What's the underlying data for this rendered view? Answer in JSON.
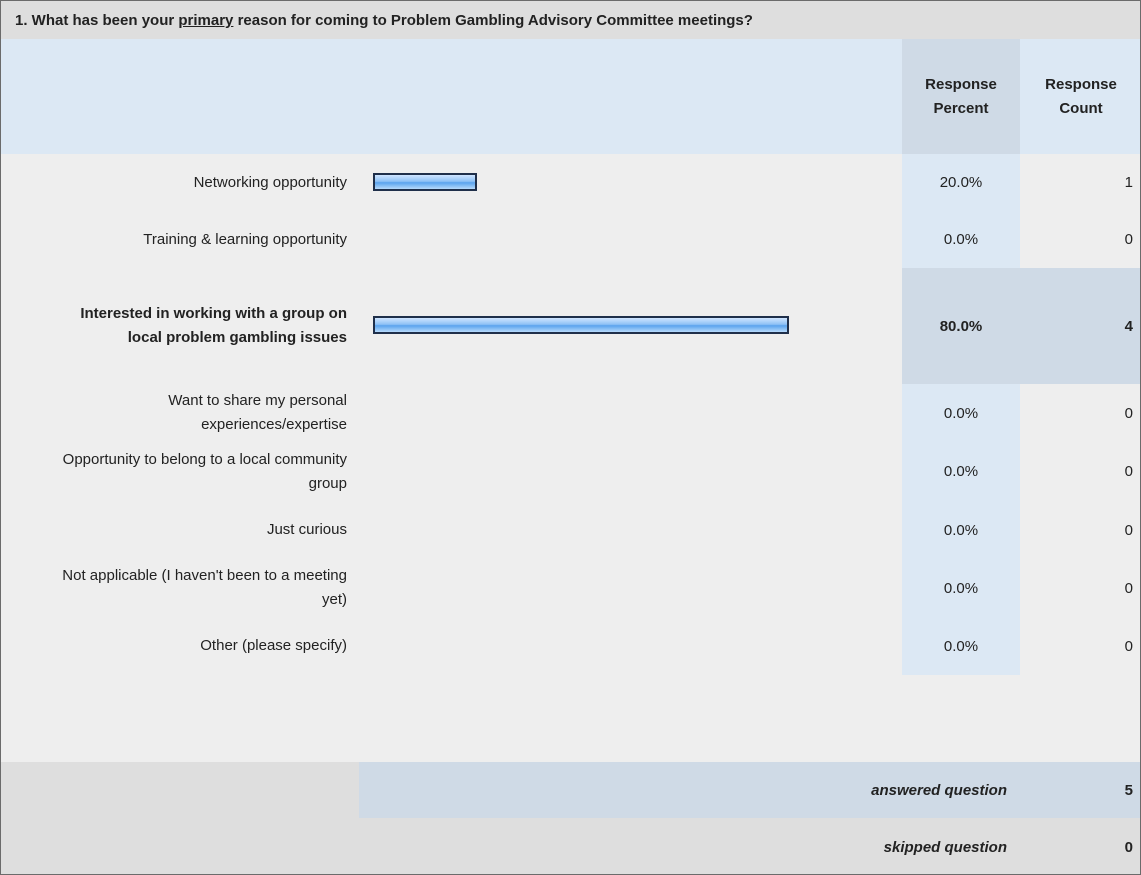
{
  "question": {
    "prefix": "1. What has been your ",
    "emphasis": "primary",
    "suffix": " reason for coming to Problem Gambling Advisory Committee meetings?"
  },
  "headers": {
    "percent_line1": "Response",
    "percent_line2": "Percent",
    "count_line1": "Response",
    "count_line2": "Count"
  },
  "chart_data": {
    "type": "bar",
    "categories": [
      "Networking opportunity",
      "Training & learning opportunity",
      "Interested in working with a group on local problem gambling issues",
      "Want to share my personal experiences/expertise",
      "Opportunity to belong to a local community group",
      "Just curious",
      "Not applicable (I haven't been to a meeting yet)",
      "Other (please specify)"
    ],
    "series": [
      {
        "values": [
          20.0,
          0.0,
          80.0,
          0.0,
          0.0,
          0.0,
          0.0,
          0.0
        ]
      }
    ],
    "ylim": [
      0,
      100
    ]
  },
  "rows": [
    {
      "label": "Networking opportunity",
      "percent": "20.0%",
      "count": "1",
      "value": 20
    },
    {
      "label": "Training & learning opportunity",
      "percent": "0.0%",
      "count": "0",
      "value": 0
    },
    {
      "label": "Interested in working with a group on local problem gambling issues",
      "percent": "80.0%",
      "count": "4",
      "value": 80,
      "highlight": true
    },
    {
      "label": "Want to share my personal experiences/expertise",
      "percent": "0.0%",
      "count": "0",
      "value": 0
    },
    {
      "label": "Opportunity to belong to a local community group",
      "percent": "0.0%",
      "count": "0",
      "value": 0
    },
    {
      "label": "Just curious",
      "percent": "0.0%",
      "count": "0",
      "value": 0
    },
    {
      "label": "Not applicable (I haven't been to a meeting yet)",
      "percent": "0.0%",
      "count": "0",
      "value": 0
    },
    {
      "label": "Other (please specify)",
      "percent": "0.0%",
      "count": "0",
      "value": 0
    }
  ],
  "summary": {
    "answered_label": "answered question",
    "answered_value": "5",
    "skipped_label": "skipped question",
    "skipped_value": "0"
  },
  "colors": {
    "bar_border": "#1f2f4a",
    "bar_fill": "#5aa3ee",
    "header_bg": "#dce8f4",
    "highlight_bg": "#cfdae6"
  }
}
